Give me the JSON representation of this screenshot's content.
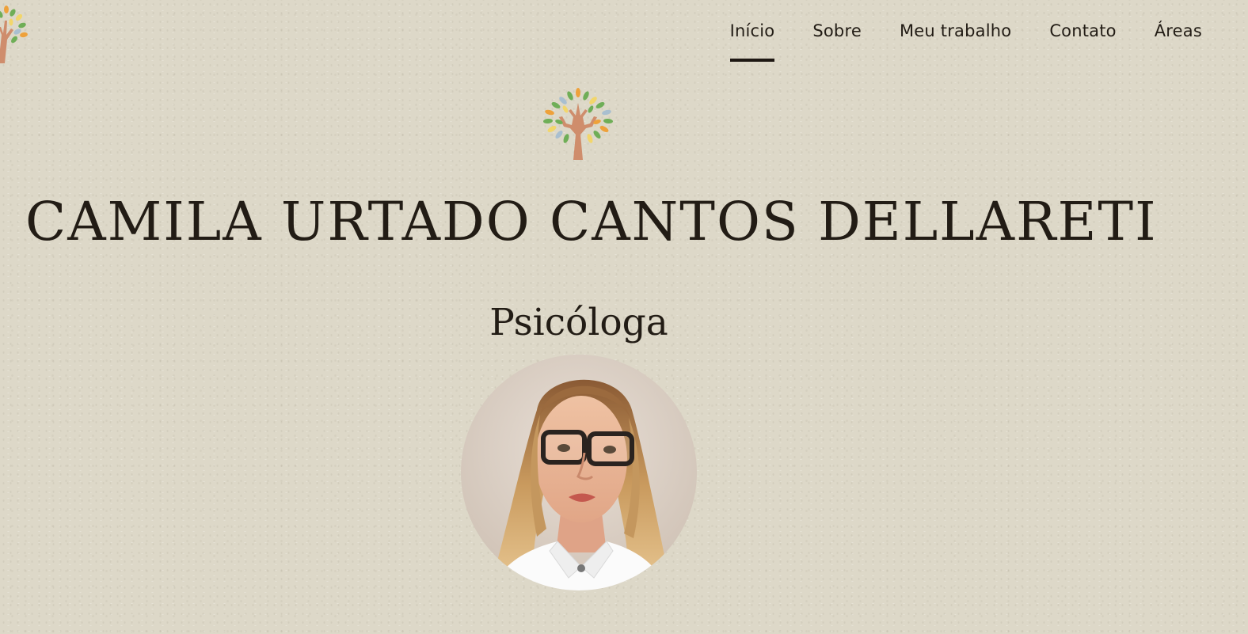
{
  "header": {
    "logo_icon": "tree-logo-icon",
    "nav": [
      {
        "label": "Início",
        "active": true
      },
      {
        "label": "Sobre",
        "active": false
      },
      {
        "label": "Meu trabalho",
        "active": false
      },
      {
        "label": "Contato",
        "active": false
      },
      {
        "label": "Áreas",
        "active": false
      }
    ]
  },
  "hero": {
    "logo_icon": "tree-logo-icon",
    "name": "CAMILA URTADO CANTOS DELLARETI",
    "profession": "Psicóloga",
    "photo_icon": "profile-photo"
  },
  "colors": {
    "background": "#ddd8c8",
    "text": "#221c15",
    "tree_trunk": "#cf8d6c",
    "leaf_green": "#6fae57",
    "leaf_orange": "#eea13a",
    "leaf_yellow": "#f2d66b",
    "leaf_blue": "#a9bfd0"
  }
}
